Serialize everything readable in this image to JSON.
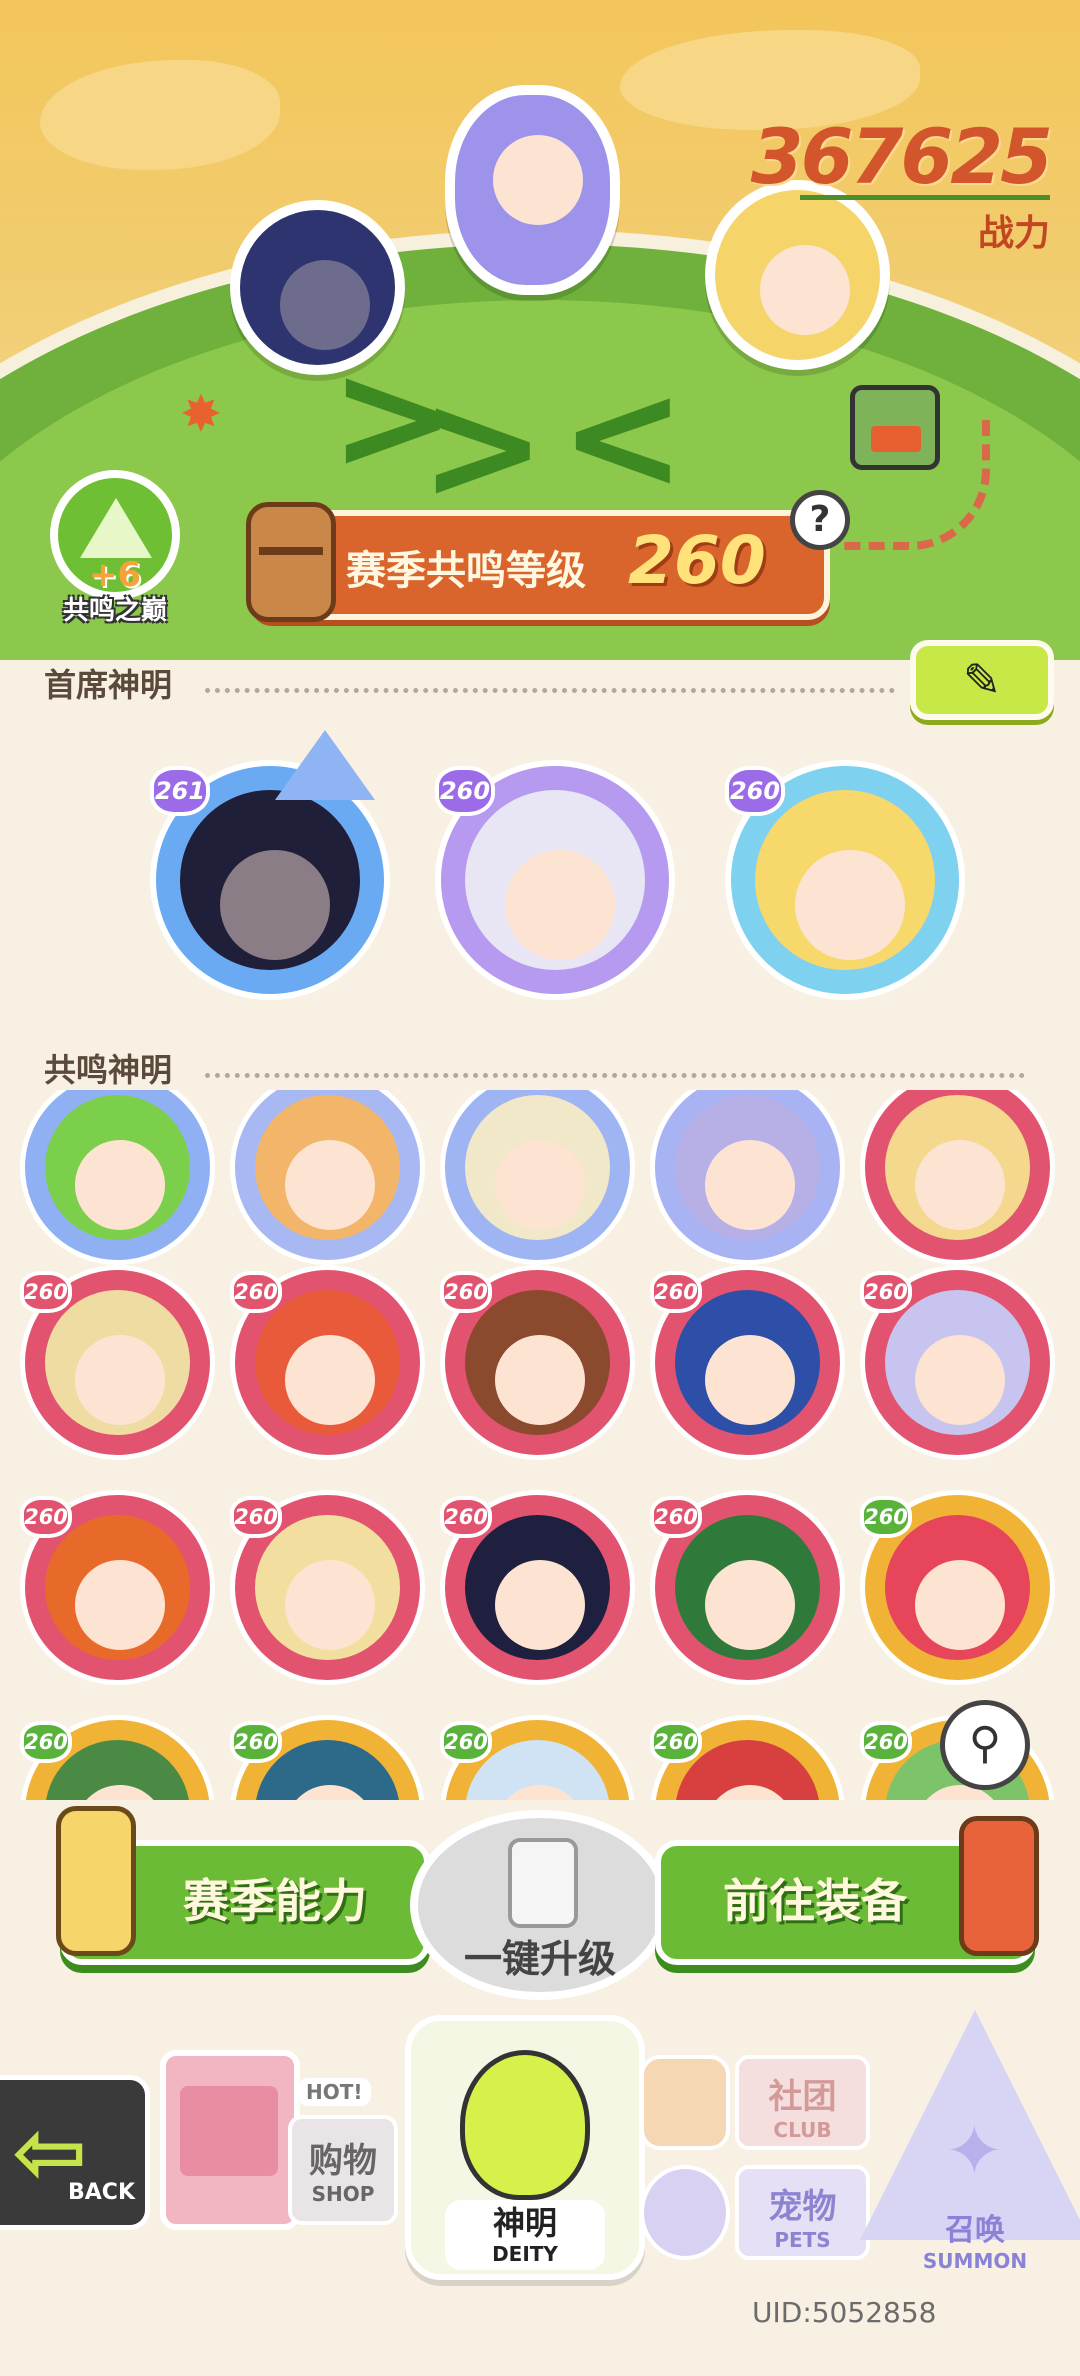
{
  "header": {
    "power_value": "367625",
    "power_label": "战力"
  },
  "resonance_peak": {
    "bonus": "+6",
    "label": "共鸣之巅"
  },
  "season": {
    "label": "赛季共鸣等级",
    "level": "260",
    "help_icon": "question-icon"
  },
  "leaders": {
    "title": "首席神明",
    "edit_icon": "pencil-icon",
    "items": [
      {
        "level": "261",
        "ring": "#6aaaf2",
        "hair": "#1f1f3a",
        "skin": "#8a7d85",
        "crowned": true
      },
      {
        "level": "260",
        "ring": "#b59af0",
        "hair": "#e8e6f5",
        "skin": "#fde4d2",
        "crowned": false
      },
      {
        "level": "260",
        "ring": "#7fd1f0",
        "hair": "#f6d86b",
        "skin": "#fde4d2",
        "crowned": false
      }
    ]
  },
  "resonance": {
    "title": "共鸣神明",
    "rows": [
      [
        {
          "level": "",
          "ring": "#8fb0f2",
          "hair": "#7ccf4a"
        },
        {
          "level": "",
          "ring": "#a7b8f2",
          "hair": "#f2b56a"
        },
        {
          "level": "",
          "ring": "#9fb4f3",
          "hair": "#f1e7c9"
        },
        {
          "level": "",
          "ring": "#a7b3f2",
          "hair": "#b7b0e6"
        },
        {
          "level": "",
          "ring": "#e2536f",
          "hair": "#f3d88e"
        }
      ],
      [
        {
          "level": "260",
          "ring": "#e2536f",
          "hair": "#efdca2"
        },
        {
          "level": "260",
          "ring": "#e2536f",
          "hair": "#e95a3b"
        },
        {
          "level": "260",
          "ring": "#e2536f",
          "hair": "#8b4a2d"
        },
        {
          "level": "260",
          "ring": "#e2536f",
          "hair": "#2d4fa8"
        },
        {
          "level": "260",
          "ring": "#e2536f",
          "hair": "#c7c4ef"
        }
      ],
      [
        {
          "level": "260",
          "ring": "#e2536f",
          "hair": "#e86a2a"
        },
        {
          "level": "260",
          "ring": "#e2536f",
          "hair": "#f2dfa0"
        },
        {
          "level": "260",
          "ring": "#e2536f",
          "hair": "#1f2040"
        },
        {
          "level": "260",
          "ring": "#e2536f",
          "hair": "#2f7a3a"
        },
        {
          "level": "260",
          "ring": "#f0b336",
          "hair": "#e6455a"
        }
      ],
      [
        {
          "level": "260",
          "ring": "#f0b336",
          "hair": "#4b8a45"
        },
        {
          "level": "260",
          "ring": "#f0b336",
          "hair": "#2d6a8a"
        },
        {
          "level": "260",
          "ring": "#f0b336",
          "hair": "#cfe3f5"
        },
        {
          "level": "260",
          "ring": "#f0b336",
          "hair": "#d84040"
        },
        {
          "level": "260",
          "ring": "#f0b336",
          "hair": "#7cc36a"
        }
      ]
    ],
    "filter_icon": "filter-icon"
  },
  "actions": {
    "season_ability": "赛季能力",
    "one_click_upgrade": "一键升级",
    "go_equip": "前往装备"
  },
  "nav": {
    "back_en": "BACK",
    "shop_cn": "购物",
    "shop_en": "SHOP",
    "hot": "HOT!",
    "deity_cn": "神明",
    "deity_en": "DEITY",
    "club_cn": "社团",
    "club_en": "CLUB",
    "pets_cn": "宠物",
    "pets_en": "PETS",
    "summon_cn": "召唤",
    "summon_en": "SUMMON"
  },
  "uid": "UID:5052858",
  "colors": {
    "accent_green": "#6cbb37",
    "accent_orange": "#d9652c",
    "power_red": "#d2552b",
    "background": "#f8f1e3"
  }
}
